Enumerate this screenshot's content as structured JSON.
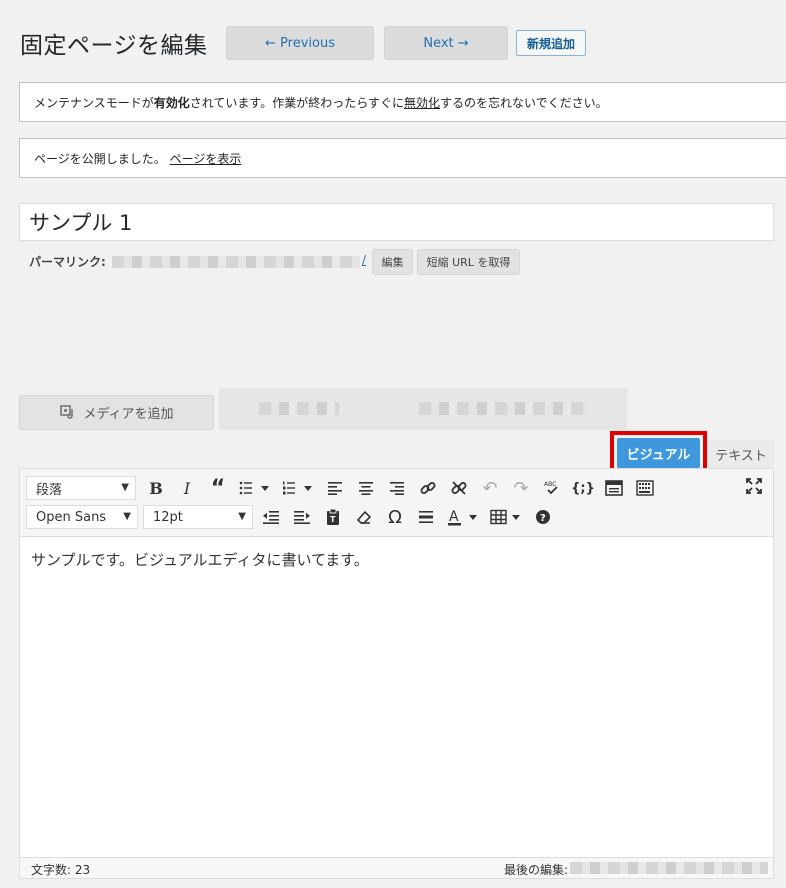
{
  "header": {
    "title": "固定ページを編集",
    "previous_label": "← Previous",
    "next_label": "Next →",
    "add_new_label": "新規追加"
  },
  "notices": {
    "maintenance": {
      "prefix": "メンテナンスモードが",
      "bold": "有効化",
      "middle": "されています。作業が終わったらすぐに",
      "link": "無効化",
      "suffix": "するのを忘れないでください。"
    },
    "published": {
      "text": "ページを公開しました。",
      "link": "ページを表示"
    }
  },
  "post": {
    "title_value": "サンプル 1",
    "permalink_label": "パーマリンク:",
    "permalink_slash": "/",
    "edit_button": "編集",
    "shortlink_button": "短縮 URL を取得"
  },
  "media": {
    "add_media_label": "メディアを追加"
  },
  "editor_tabs": {
    "visual": "ビジュアル",
    "text": "テキスト"
  },
  "toolbar": {
    "format_select": "段落",
    "font_family_select": "Open Sans",
    "font_size_select": "12pt"
  },
  "icons": [
    "bold-icon",
    "italic-icon",
    "blockquote-icon",
    "bullet-list-icon",
    "numbered-list-icon",
    "align-left-icon",
    "align-center-icon",
    "align-right-icon",
    "link-icon",
    "unlink-icon",
    "undo-icon",
    "redo-icon",
    "spellcheck-icon",
    "code-icon",
    "read-more-icon",
    "toolbar-toggle-icon",
    "fullscreen-icon",
    "outdent-icon",
    "indent-icon",
    "paste-text-icon",
    "clear-formatting-icon",
    "special-character-icon",
    "horizontal-line-icon",
    "text-color-icon",
    "table-icon",
    "help-icon"
  ],
  "content": {
    "body": "サンプルです。ビジュアルエディタに書いてます。"
  },
  "statusbar": {
    "word_count": "文字数: 23",
    "last_edited_label": "最後の編集:"
  },
  "colors": {
    "visual_tab": "#3f97dd",
    "highlight": "#e00000",
    "link": "#2271b1"
  }
}
